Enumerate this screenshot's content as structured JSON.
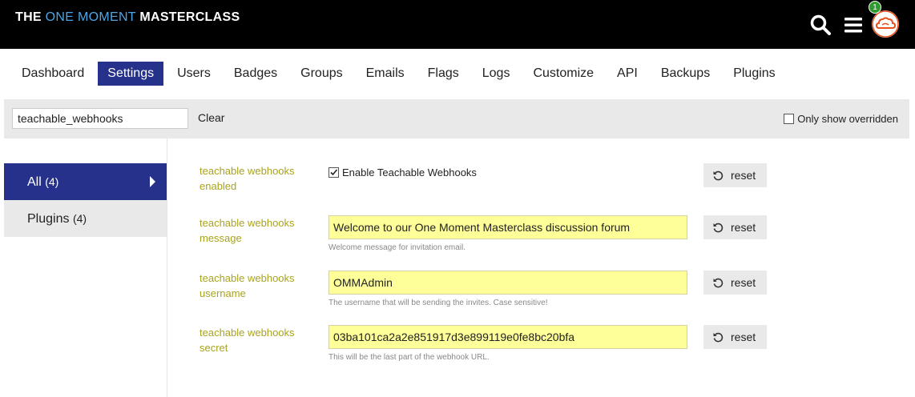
{
  "header": {
    "logo_word1": "THE ",
    "logo_word2": "ONE MOMENT ",
    "logo_word3": "MASTERCLASS",
    "notification_count": "1"
  },
  "nav": {
    "tabs": [
      "Dashboard",
      "Settings",
      "Users",
      "Badges",
      "Groups",
      "Emails",
      "Flags",
      "Logs",
      "Customize",
      "API",
      "Backups",
      "Plugins"
    ],
    "active": "Settings"
  },
  "filter": {
    "search_value": "teachable_webhooks",
    "clear_label": "Clear",
    "only_overridden_label": "Only show overridden"
  },
  "sidebar": {
    "items": [
      {
        "label": "All",
        "count": "(4)"
      },
      {
        "label": "Plugins",
        "count": "(4)"
      }
    ]
  },
  "settings": [
    {
      "label": "teachable webhooks enabled",
      "checkbox_label": "Enable Teachable Webhooks",
      "checked": true
    },
    {
      "label": "teachable webhooks message",
      "value": "Welcome to our One Moment Masterclass discussion forum",
      "description": "Welcome message for invitation email."
    },
    {
      "label": "teachable webhooks username",
      "value": "OMMAdmin",
      "description": "The username that will be sending the invites. Case sensitive!"
    },
    {
      "label": "teachable webhooks secret",
      "value": "03ba101ca2a2e851917d3e899119e0fe8bc20bfa",
      "description": "This will be the last part of the webhook URL."
    }
  ],
  "reset_label": "reset",
  "colors": {
    "header_bg": "#000000",
    "accent_blue": "#4ca6e8",
    "active_tab": "#25318a",
    "setting_label": "#a8a31f",
    "input_highlight": "#ffff99",
    "avatar_orange": "#e8501e",
    "badge_green": "#2e9a2e"
  }
}
